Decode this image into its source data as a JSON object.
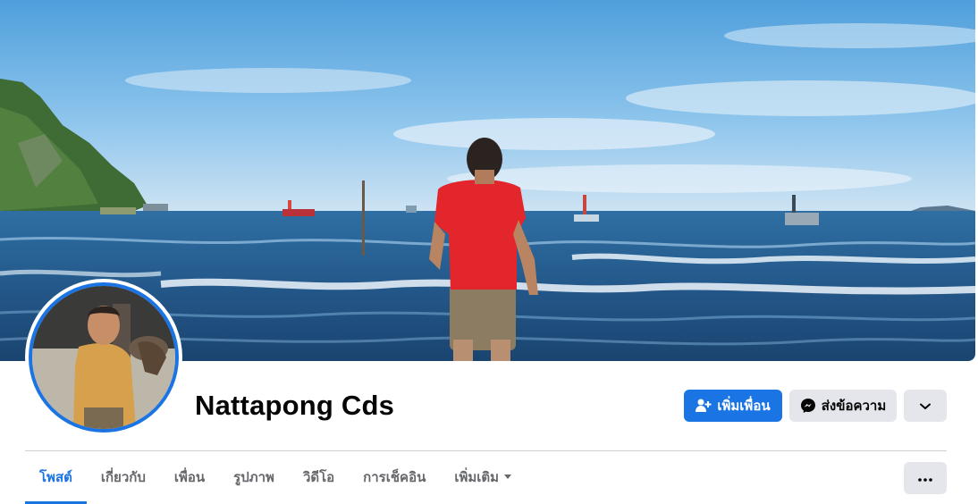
{
  "profile": {
    "name": "Nattapong Cds"
  },
  "actions": {
    "add_friend_label": "เพิ่มเพื่อน",
    "message_label": "ส่งข้อความ"
  },
  "tabs": [
    {
      "label": "โพสต์",
      "active": true
    },
    {
      "label": "เกี่ยวกับ",
      "active": false
    },
    {
      "label": "เพื่อน",
      "active": false
    },
    {
      "label": "รูปภาพ",
      "active": false
    },
    {
      "label": "วิดีโอ",
      "active": false
    },
    {
      "label": "การเช็คอิน",
      "active": false
    },
    {
      "label": "เพิ่มเติม",
      "active": false,
      "has_dropdown": true
    }
  ],
  "icons": {
    "add_friend": "person-plus-icon",
    "message": "messenger-icon",
    "more_actions": "chevron-down-icon",
    "tabs_more": "ellipsis-icon",
    "tab_dropdown": "caret-down-icon"
  },
  "colors": {
    "accent": "#1b74e4",
    "secondary_button": "#e4e6eb",
    "text_primary": "#050505",
    "text_secondary": "#65676b",
    "divider": "#ced0d4"
  }
}
